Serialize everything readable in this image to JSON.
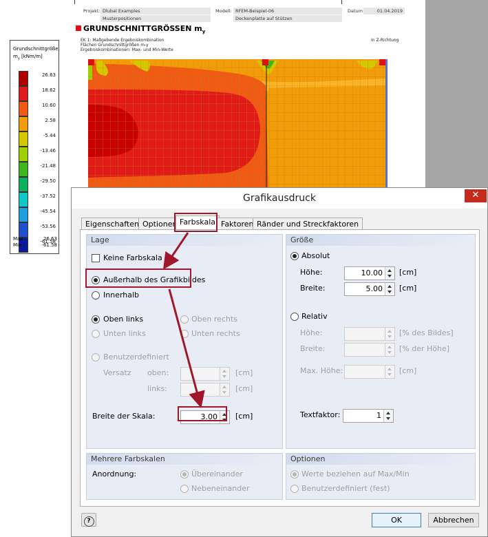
{
  "report": {
    "header": {
      "project_label": "Projekt:",
      "project_value": "Dlubal Examples",
      "project_sub": "Musterpositionen",
      "model_label": "Modell:",
      "model_value": "RFEM-Beispiel-06",
      "model_sub": "Deckenplatte auf Stützen",
      "date_label": "Datum:",
      "date_value": "01.04.2019"
    },
    "section_title": "GRUNDSCHNITTGRÖSSEN m",
    "section_title_sub": "y",
    "info_lines": [
      "EK 1: Maßgebende Ergebniskombination",
      "Flächen Grundschnittgrößen m-y",
      "Ergebniskombinationen: Max- und Min-Werte"
    ],
    "direction": "In Z-Richtung",
    "legend": {
      "title_line1": "Grundschnittgröße",
      "title_line2": "m",
      "title_sub": "y",
      "title_unit": " [kNm/m]",
      "values": [
        "26.63",
        "18.62",
        "10.60",
        "2.58",
        "-5.44",
        "-13.46",
        "-21.48",
        "-29.50",
        "-37.52",
        "-45.54",
        "-53.56",
        "-61.58"
      ],
      "colors": [
        "#b00000",
        "#e11a1a",
        "#f05a14",
        "#f39c0a",
        "#d6c800",
        "#9fd000",
        "#3fb61e",
        "#0fae5c",
        "#10c8c8",
        "#1ea0e0",
        "#1e50d0",
        "#0a1a9c"
      ],
      "max_label": "Max :",
      "max_value": "26.63",
      "min_label": "Min :",
      "min_value": "-61.58"
    }
  },
  "dialog": {
    "title": "Grafikausdruck",
    "close_glyph": "✕",
    "tabs": [
      "Eigenschaften",
      "Optionen",
      "Farbskala",
      "Faktoren",
      "Ränder und Streckfaktoren"
    ],
    "active_tab": "Farbskala",
    "lage": {
      "header": "Lage",
      "keine_farbskala": "Keine Farbskala",
      "ausserhalb": "Außerhalb des Grafikbildes",
      "innerhalb": "Innerhalb",
      "oben_links": "Oben links",
      "oben_rechts": "Oben rechts",
      "unten_links": "Unten links",
      "unten_rechts": "Unten rechts",
      "benutzerdefiniert": "Benutzerdefiniert",
      "versatz": "Versatz",
      "oben": "oben:",
      "links": "links:",
      "unit_cm": "[cm]",
      "breite_der_skala": "Breite der Skala:",
      "breite_value": "3.00"
    },
    "groesse": {
      "header": "Größe",
      "absolut": "Absolut",
      "hoehe": "Höhe:",
      "hoehe_value": "10.00",
      "breite": "Breite:",
      "breite_value": "5.00",
      "unit_cm": "[cm]",
      "relativ": "Relativ",
      "rel_hoehe": "Höhe:",
      "rel_hoehe_unit": "[% des Bildes]",
      "rel_breite": "Breite:",
      "rel_breite_unit": "[% der Höhe]",
      "max_hoehe": "Max. Höhe:",
      "max_hoehe_unit": "[cm]",
      "textfaktor": "Textfaktor:",
      "textfaktor_value": "1"
    },
    "mehrere": {
      "header": "Mehrere Farbskalen",
      "anordnung": "Anordnung:",
      "uebereinander": "Übereinander",
      "nebeneinander": "Nebeneinander"
    },
    "optionen": {
      "header": "Optionen",
      "werte_max_min": "Werte beziehen auf Max/Min",
      "benutzerdefiniert_fest": "Benutzerdefiniert (fest)"
    },
    "buttons": {
      "help_glyph": "?",
      "ok": "OK",
      "cancel": "Abbrechen"
    }
  },
  "colors": {
    "highlight": "#a0162a",
    "close_red": "#c42b1c",
    "group_bg": "#e7ecf5"
  }
}
